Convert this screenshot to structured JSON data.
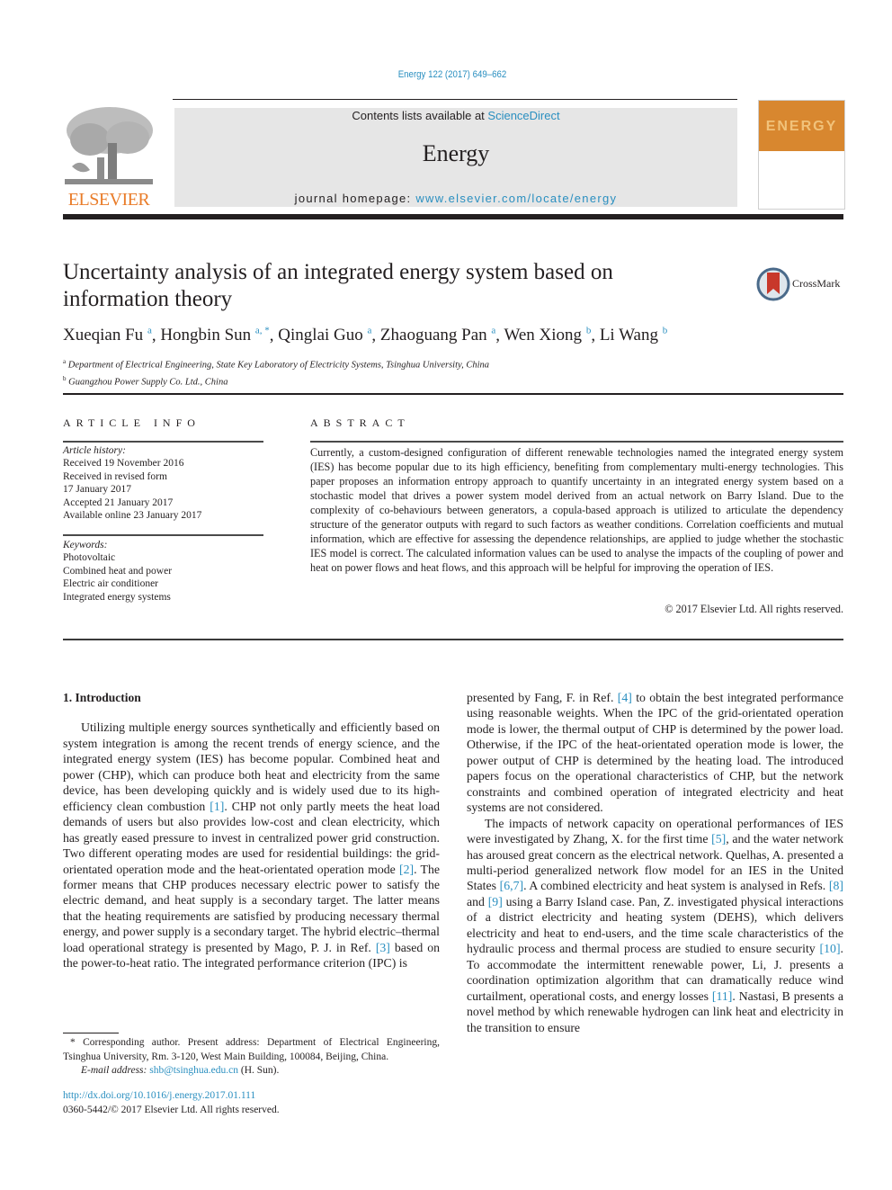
{
  "header": {
    "citation": "Energy 122 (2017) 649–662",
    "contents_prefix": "Contents lists available at ",
    "contents_link": "ScienceDirect",
    "journal_name": "Energy",
    "homepage_prefix": "journal homepage: ",
    "homepage_link": "www.elsevier.com/locate/energy",
    "publisher_logo_text": "ELSEVIER",
    "cover_title": "ENERGY",
    "colors": {
      "link": "#2a8fc0",
      "elsevier_orange": "#e97c29",
      "cover_orange": "#d8872f",
      "masthead_bg": "#e6e6e6"
    }
  },
  "article": {
    "title": "Uncertainty analysis of an integrated energy system based on information theory",
    "crossmark_label": "CrossMark",
    "authors": [
      {
        "name": "Xueqian Fu",
        "sup": "a"
      },
      {
        "name": "Hongbin Sun",
        "sup": "a, *"
      },
      {
        "name": "Qinglai Guo",
        "sup": "a"
      },
      {
        "name": "Zhaoguang Pan",
        "sup": "a"
      },
      {
        "name": "Wen Xiong",
        "sup": "b"
      },
      {
        "name": "Li Wang",
        "sup": "b"
      }
    ],
    "affiliations": [
      {
        "sup": "a",
        "text": "Department of Electrical Engineering, State Key Laboratory of Electricity Systems, Tsinghua University, China"
      },
      {
        "sup": "b",
        "text": "Guangzhou Power Supply Co. Ltd., China"
      }
    ]
  },
  "article_info": {
    "heading": "ARTICLE INFO",
    "history_label": "Article history:",
    "history": [
      "Received 19 November 2016",
      "Received in revised form",
      "17 January 2017",
      "Accepted 21 January 2017",
      "Available online 23 January 2017"
    ],
    "keywords_label": "Keywords:",
    "keywords": [
      "Photovoltaic",
      "Combined heat and power",
      "Electric air conditioner",
      "Integrated energy systems"
    ]
  },
  "abstract": {
    "heading": "ABSTRACT",
    "text": "Currently, a custom-designed configuration of different renewable technologies named the integrated energy system (IES) has become popular due to its high efficiency, benefiting from complementary multi-energy technologies. This paper proposes an information entropy approach to quantify uncertainty in an integrated energy system based on a stochastic model that drives a power system model derived from an actual network on Barry Island. Due to the complexity of co-behaviours between generators, a copula-based approach is utilized to articulate the dependency structure of the generator outputs with regard to such factors as weather conditions. Correlation coefficients and mutual information, which are effective for assessing the dependence relationships, are applied to judge whether the stochastic IES model is correct. The calculated information values can be used to analyse the impacts of the coupling of power and heat on power flows and heat flows, and this approach will be helpful for improving the operation of IES.",
    "copyright": "© 2017 Elsevier Ltd. All rights reserved."
  },
  "body": {
    "section_heading": "1.  Introduction",
    "left_col": {
      "p1_a": "Utilizing multiple energy sources synthetically and efficiently based on system integration is among the recent trends of energy science, and the integrated energy system (IES) has become popular. Combined heat and power (CHP), which can produce both heat and electricity from the same device, has been developing quickly and is widely used due to its high-efficiency clean combustion ",
      "ref1": "[1]",
      "p1_b": ". CHP not only partly meets the heat load demands of users but also provides low-cost and clean electricity, which has greatly eased pressure to invest in centralized power grid construction. Two different operating modes are used for residential buildings: the grid-orientated operation mode and the heat-orientated operation mode ",
      "ref2": "[2]",
      "p1_c": ". The former means that CHP produces necessary electric power to satisfy the electric demand, and heat supply is a secondary target. The latter means that the heating requirements are satisfied by producing necessary thermal energy, and power supply is a secondary target. The hybrid electric–thermal load operational strategy is presented by Mago, P. J. in Ref. ",
      "ref3": "[3]",
      "p1_d": " based on the power-to-heat ratio. The integrated performance criterion (IPC) is"
    },
    "right_col": {
      "p1_a": "presented by Fang, F. in Ref. ",
      "ref4": "[4]",
      "p1_b": " to obtain the best integrated performance using reasonable weights. When the IPC of the grid-orientated operation mode is lower, the thermal output of CHP is determined by the power load. Otherwise, if the IPC of the heat-orientated operation mode is lower, the power output of CHP is determined by the heating load. The introduced papers focus on the operational characteristics of CHP, but the network constraints and combined operation of integrated electricity and heat systems are not considered.",
      "p2_a": "The impacts of network capacity on operational performances of IES were investigated by Zhang, X. for the first time ",
      "ref5": "[5]",
      "p2_b": ", and the water network has aroused great concern as the electrical network. Quelhas, A. presented a multi-period generalized network flow model for an IES in the United States ",
      "ref67": "[6,7]",
      "p2_c": ". A combined electricity and heat system is analysed in Refs. ",
      "ref8": "[8]",
      "p2_d": " and ",
      "ref9": "[9]",
      "p2_e": " using a Barry Island case. Pan, Z. investigated physical interactions of a district electricity and heating system (DEHS), which delivers electricity and heat to end-users, and the time scale characteristics of the hydraulic process and thermal process are studied to ensure security ",
      "ref10": "[10]",
      "p2_f": ". To accommodate the intermittent renewable power, Li, J. presents a coordination optimization algorithm that can dramatically reduce wind curtailment, operational costs, and energy losses ",
      "ref11": "[11]",
      "p2_g": ". Nastasi, B presents a novel method by which renewable hydrogen can link heat and electricity in the transition to ensure"
    }
  },
  "footer": {
    "footnote": "* Corresponding author. Present address: Department of Electrical Engineering, Tsinghua University, Rm. 3-120, West Main Building, 100084, Beijing, China.",
    "email_label": "E-mail address: ",
    "email": "shb@tsinghua.edu.cn",
    "email_suffix": " (H. Sun).",
    "doi": "http://dx.doi.org/10.1016/j.energy.2017.01.111",
    "issn_copyright": "0360-5442/© 2017 Elsevier Ltd. All rights reserved."
  }
}
